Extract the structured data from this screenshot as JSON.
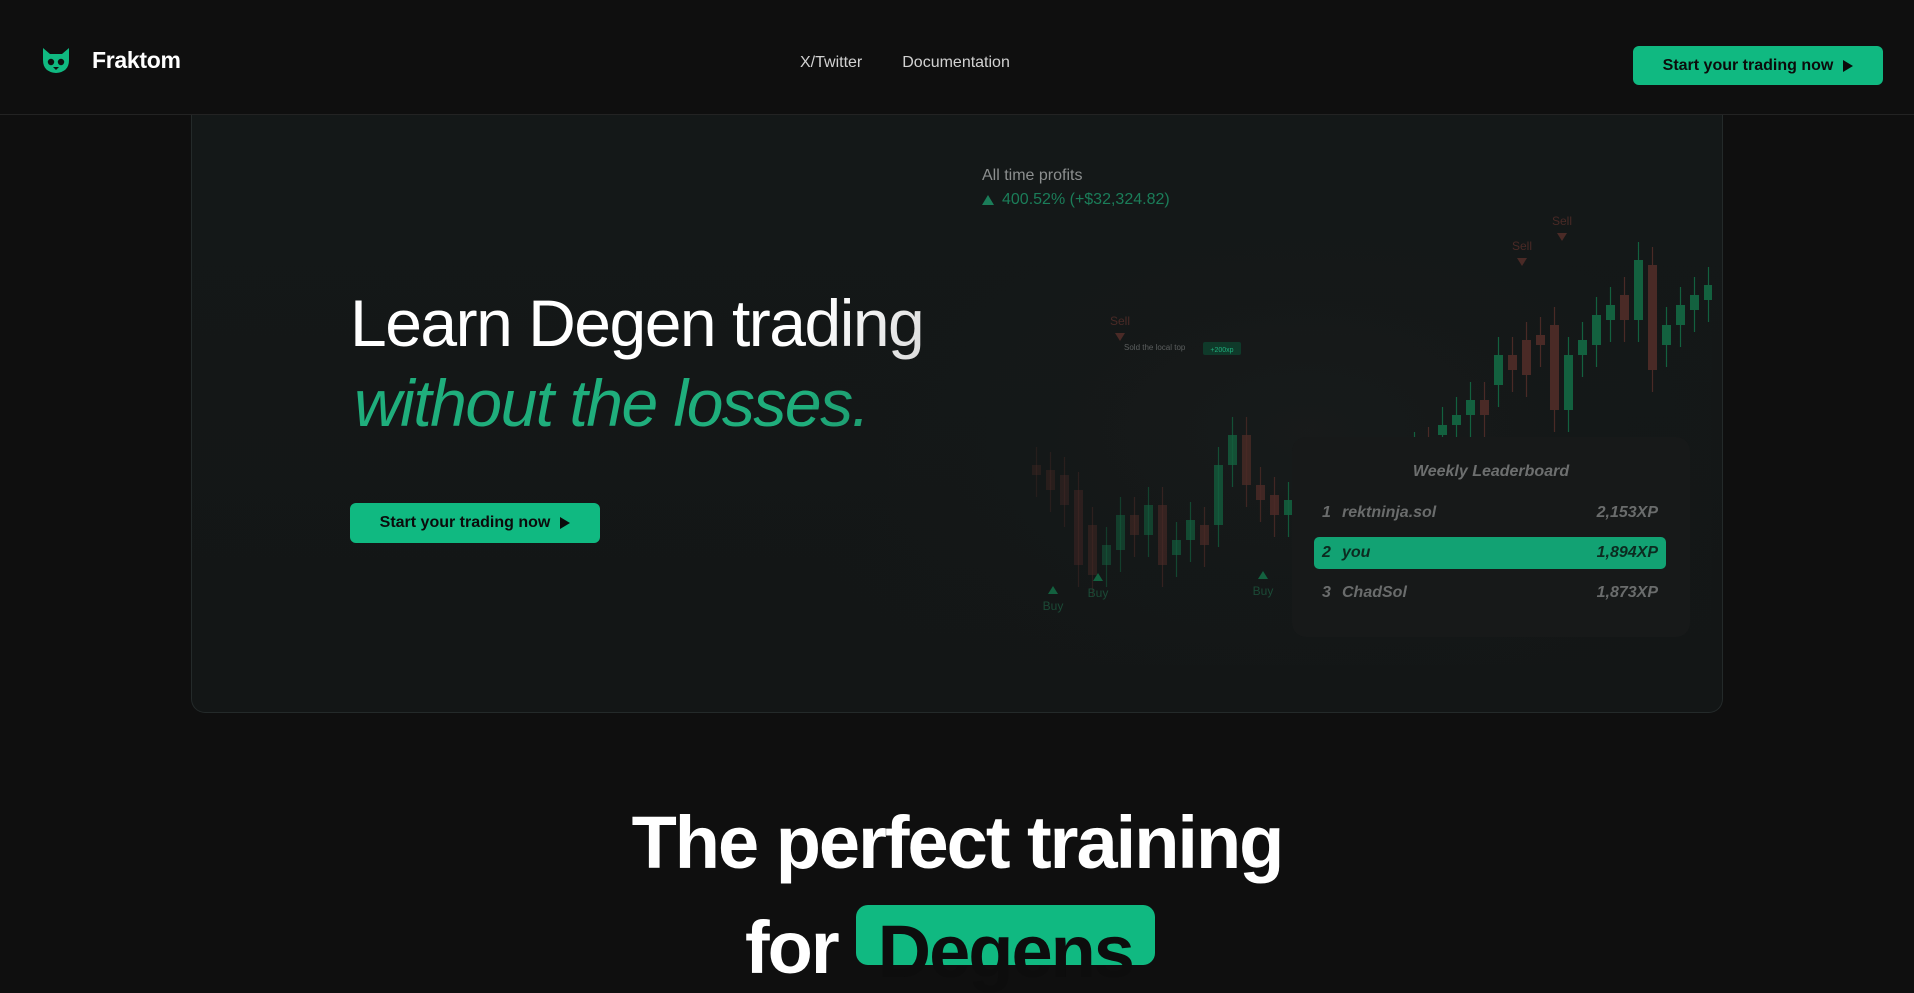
{
  "header": {
    "brand": "Fraktom",
    "nav": [
      "X/Twitter",
      "Documentation"
    ],
    "cta_label": "Start your trading now"
  },
  "hero": {
    "title": "Learn Degen trading",
    "subtitle": "without the losses.",
    "cta_label": "Start your trading now",
    "profits_label": "All time profits",
    "profits_value": "400.52% (+$32,324.82)",
    "chart": {
      "markers": [
        {
          "label": "Sell",
          "type": "sell"
        },
        {
          "label": "Sell",
          "type": "sell"
        },
        {
          "label": "Sell",
          "type": "sell"
        },
        {
          "label": "Buy",
          "type": "buy"
        },
        {
          "label": "Buy",
          "type": "buy"
        },
        {
          "label": "Buy",
          "type": "buy"
        }
      ],
      "note": "Sold the local top",
      "note_badge": "+200xp"
    },
    "leaderboard": {
      "title": "Weekly Leaderboard",
      "rows": [
        {
          "rank": "1",
          "name": "rektninja.sol",
          "xp": "2,153XP"
        },
        {
          "rank": "2",
          "name": "you",
          "xp": "1,894XP"
        },
        {
          "rank": "3",
          "name": "ChadSol",
          "xp": "1,873XP"
        }
      ]
    }
  },
  "section": {
    "title_line1": "The perfect training",
    "title_line2_prefix": "for",
    "title_line2_highlight": "Degens"
  },
  "colors": {
    "accent": "#10b981",
    "background": "#0f0f0f",
    "profit_green": "#1b7d59",
    "candle_red": "#4a2a26"
  }
}
